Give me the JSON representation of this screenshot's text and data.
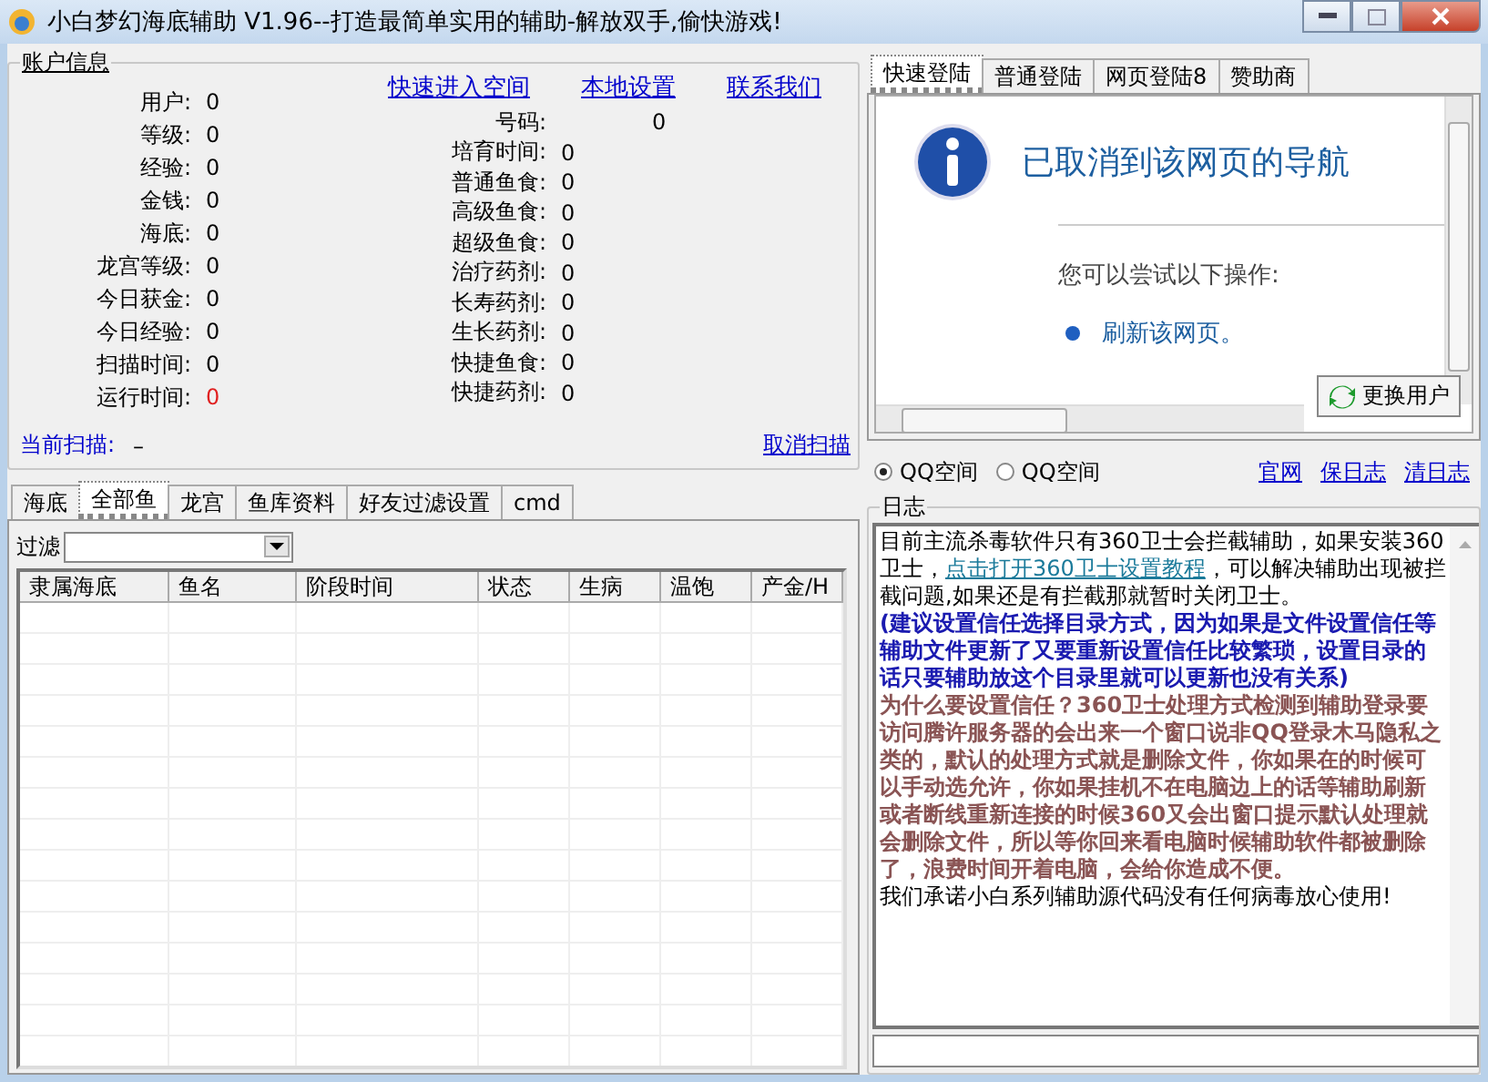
{
  "window": {
    "title": "小白梦幻海底辅助 V1.96--打造最简单实用的辅助-解放双手,偷快游戏!"
  },
  "account": {
    "title": "账户信息",
    "links": [
      "快速进入空间",
      "本地设置",
      "联系我们"
    ],
    "stats_left": [
      {
        "label": "用户:",
        "value": "0",
        "alert": false
      },
      {
        "label": "等级:",
        "value": "0",
        "alert": false
      },
      {
        "label": "经验:",
        "value": "0",
        "alert": false
      },
      {
        "label": "金钱:",
        "value": "0",
        "alert": false
      },
      {
        "label": "海底:",
        "value": "0",
        "alert": false
      },
      {
        "label": "龙宫等级:",
        "value": "0",
        "alert": false
      },
      {
        "label": "今日获金:",
        "value": "0",
        "alert": false
      },
      {
        "label": "今日经验:",
        "value": "0",
        "alert": false
      },
      {
        "label": "扫描时间:",
        "value": "0",
        "alert": false
      },
      {
        "label": "运行时间:",
        "value": "0",
        "alert": true
      }
    ],
    "number": {
      "label": "号码:",
      "value": "0"
    },
    "stats_right": [
      {
        "label": "培育时间:",
        "value": "0"
      },
      {
        "label": "普通鱼食:",
        "value": "0"
      },
      {
        "label": "高级鱼食:",
        "value": "0"
      },
      {
        "label": "超级鱼食:",
        "value": "0"
      },
      {
        "label": "治疗药剂:",
        "value": "0"
      },
      {
        "label": "长寿药剂:",
        "value": "0"
      },
      {
        "label": "生长药剂:",
        "value": "0"
      },
      {
        "label": "快捷鱼食:",
        "value": "0"
      },
      {
        "label": "快捷药剂:",
        "value": "0"
      }
    ],
    "current_scan": {
      "label": "当前扫描:",
      "value": "–"
    },
    "cancel_link": "取消扫描"
  },
  "bottom_tabs": [
    {
      "label": "海底",
      "selected": false
    },
    {
      "label": "全部鱼",
      "selected": true
    },
    {
      "label": "龙宫",
      "selected": false
    },
    {
      "label": "鱼库资料",
      "selected": false
    },
    {
      "label": "好友过滤设置",
      "selected": false
    },
    {
      "label": "cmd",
      "selected": false
    }
  ],
  "filter": {
    "label": "过滤"
  },
  "table": {
    "columns": [
      "隶属海底",
      "鱼名",
      "阶段时间",
      "状态",
      "生病",
      "温饱",
      "产金/H"
    ]
  },
  "login_tabs": [
    {
      "label": "快速登陆",
      "selected": true
    },
    {
      "label": "普通登陆",
      "selected": false
    },
    {
      "label": "网页登陆8",
      "selected": false
    },
    {
      "label": "赞助商",
      "selected": false
    }
  ],
  "browser": {
    "heading": "已取消到该网页的导航",
    "hint": "您可以尝试以下操作:",
    "action": "刷新该网页。"
  },
  "switch_user_button": "更换用户",
  "radios": [
    {
      "label": "QQ空间",
      "selected": true
    },
    {
      "label": "QQ空间",
      "selected": false
    }
  ],
  "log_links": [
    "官网",
    "保日志",
    "清日志"
  ],
  "log": {
    "title": "日志",
    "paragraphs": [
      {
        "kind": "plain",
        "parts": [
          {
            "kind": "text",
            "text": "目前主流杀毒软件只有360卫士会拦截辅助，如果安装360卫士，"
          },
          {
            "kind": "link",
            "text": "点击打开360卫士设置教程"
          },
          {
            "kind": "text",
            "text": "，可以解决辅助出现被拦截问题,如果还是有拦截那就暂时关闭卫士。"
          }
        ]
      },
      {
        "kind": "notice",
        "parts": [
          {
            "kind": "text",
            "text": "(建议设置信任选择目录方式，因为如果是文件设置信任等辅助文件更新了又要重新设置信任比较繁琐，设置目录的话只要辅助放这个目录里就可以更新也没有关系)"
          }
        ]
      },
      {
        "kind": "warning",
        "parts": [
          {
            "kind": "text",
            "text": "为什么要设置信任？360卫士处理方式检测到辅助登录要访问腾许服务器的会出来一个窗口说非QQ登录木马隐私之类的，默认的处理方式就是删除文件，你如果在的时候可以手动选允许，你如果挂机不在电脑边上的话等辅助刷新或者断线重新连接的时候360又会出窗口提示默认处理就会删除文件，所以等你回来看电脑时候辅助软件都被删除了，浪费时间开着电脑，会给你造成不便。"
          }
        ]
      },
      {
        "kind": "plain",
        "parts": [
          {
            "kind": "text",
            "text": "我们承诺小白系列辅助源代码没有任何病毒放心使用!"
          }
        ]
      }
    ]
  }
}
